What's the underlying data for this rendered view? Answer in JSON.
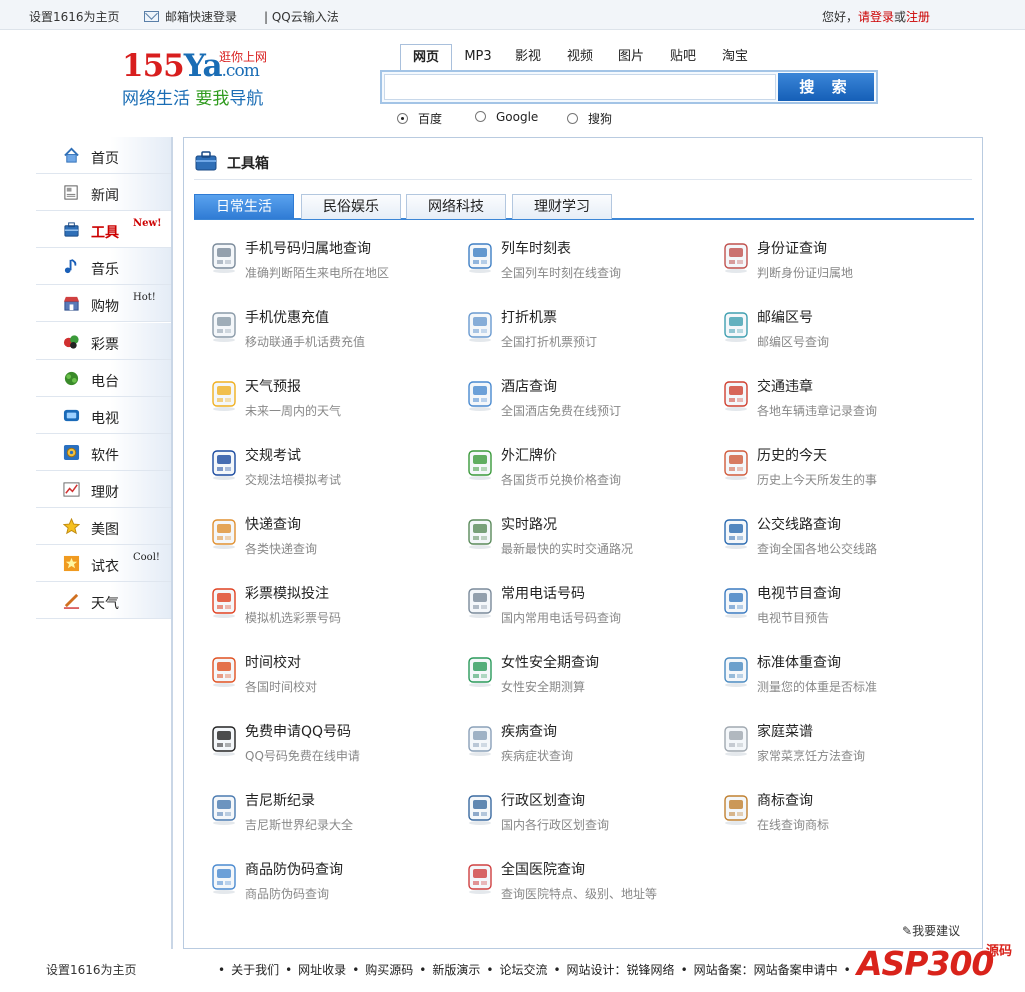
{
  "topbar": {
    "set_home": "设置1616为主页",
    "mail_login": "邮箱快速登录",
    "qq_input": "| QQ云输入法",
    "greeting": "您好，",
    "login": "请登录",
    "or": "或",
    "register": "注册"
  },
  "logo": {
    "num": "155",
    "brand": "Ya",
    "domain": ".com",
    "small": "逛你上网",
    "slogan_a": "网络生活 ",
    "slogan_b": "要我",
    "slogan_c": "导航"
  },
  "search": {
    "tabs": [
      "网页",
      "MP3",
      "影视",
      "视频",
      "图片",
      "贴吧",
      "淘宝"
    ],
    "active_tab": 0,
    "input_value": "",
    "button": "搜 索",
    "engines": [
      "百度",
      "Google",
      "搜狗"
    ],
    "selected_engine": 0
  },
  "sidebar": {
    "items": [
      {
        "label": "首页",
        "icon": "home-icon",
        "tag": ""
      },
      {
        "label": "新闻",
        "icon": "newspaper-icon",
        "tag": ""
      },
      {
        "label": "工具",
        "icon": "toolbox-icon",
        "tag": "New!"
      },
      {
        "label": "音乐",
        "icon": "music-note-icon",
        "tag": ""
      },
      {
        "label": "购物",
        "icon": "shop-icon",
        "tag": "Hot!"
      },
      {
        "label": "彩票",
        "icon": "lottery-balls-icon",
        "tag": ""
      },
      {
        "label": "电台",
        "icon": "radio-icon",
        "tag": ""
      },
      {
        "label": "电视",
        "icon": "tv-icon",
        "tag": ""
      },
      {
        "label": "软件",
        "icon": "software-gear-icon",
        "tag": ""
      },
      {
        "label": "理财",
        "icon": "finance-chart-icon",
        "tag": ""
      },
      {
        "label": "美图",
        "icon": "star-icon",
        "tag": ""
      },
      {
        "label": "试衣",
        "icon": "dress-star-icon",
        "tag": "Cool!"
      },
      {
        "label": "天气",
        "icon": "pencil-weather-icon",
        "tag": ""
      }
    ],
    "active": 2
  },
  "panel": {
    "title": "工具箱",
    "tabs": [
      "日常生活",
      "民俗娱乐",
      "网络科技",
      "理财学习"
    ],
    "active_tab": 0,
    "tools": [
      {
        "name": "手机号码归属地查询",
        "desc": "准确判断陌生来电所在地区",
        "icon": "mobile-phone-icon",
        "color": "#7a8a9a"
      },
      {
        "name": "列车时刻表",
        "desc": "全国列车时刻在线查询",
        "icon": "train-icon",
        "color": "#3f7fc4"
      },
      {
        "name": "身份证查询",
        "desc": "判断身份证归属地",
        "icon": "id-card-search-icon",
        "color": "#c0504d"
      },
      {
        "name": "手机优惠充值",
        "desc": "移动联通手机话费充值",
        "icon": "phone-recharge-icon",
        "color": "#8a9aa8"
      },
      {
        "name": "打折机票",
        "desc": "全国打折机票预订",
        "icon": "airplane-icon",
        "color": "#6a9ad0"
      },
      {
        "name": "邮编区号",
        "desc": "邮编区号查询",
        "icon": "postbox-icon",
        "color": "#3f9fb0"
      },
      {
        "name": "天气预报",
        "desc": "未来一周内的天气",
        "icon": "sun-cloud-icon",
        "color": "#f0b020"
      },
      {
        "name": "酒店查询",
        "desc": "全国酒店免费在线预订",
        "icon": "hotel-icon",
        "color": "#4a8ad0"
      },
      {
        "name": "交通违章",
        "desc": "各地车辆违章记录查询",
        "icon": "traffic-car-icon",
        "color": "#d04030"
      },
      {
        "name": "交规考试",
        "desc": "交规法培模拟考试",
        "icon": "no-uturn-sign-icon",
        "color": "#1a4aa0"
      },
      {
        "name": "外汇牌价",
        "desc": "各国货币兑换价格查询",
        "icon": "currency-icon",
        "color": "#3a9a3a"
      },
      {
        "name": "历史的今天",
        "desc": "历史上今天所发生的事",
        "icon": "calendar-icon",
        "color": "#d05a3a"
      },
      {
        "name": "快递查询",
        "desc": "各类快递查询",
        "icon": "delivery-search-icon",
        "color": "#e09030"
      },
      {
        "name": "实时路况",
        "desc": "最新最快的实时交通路况",
        "icon": "map-icon",
        "color": "#5a8a5a"
      },
      {
        "name": "公交线路查询",
        "desc": "查询全国各地公交线路",
        "icon": "bus-icon",
        "color": "#2a6ab0"
      },
      {
        "name": "彩票模拟投注",
        "desc": "模拟机选彩票号码",
        "icon": "lottery-logo-icon",
        "color": "#e04020"
      },
      {
        "name": "常用电话号码",
        "desc": "国内常用电话号码查询",
        "icon": "telephone-icon",
        "color": "#7a8a9a"
      },
      {
        "name": "电视节目查询",
        "desc": "电视节目预告",
        "icon": "television-icon",
        "color": "#3a7ac0"
      },
      {
        "name": "时间校对",
        "desc": "各国时间校对",
        "icon": "alarm-clock-icon",
        "color": "#e05020"
      },
      {
        "name": "女性安全期查询",
        "desc": "女性安全期测算",
        "icon": "woman-icon",
        "color": "#2a9a5a"
      },
      {
        "name": "标准体重查询",
        "desc": "测量您的体重是否标准",
        "icon": "scale-icon",
        "color": "#4a8ac0"
      },
      {
        "name": "免费申请QQ号码",
        "desc": "QQ号码免费在线申请",
        "icon": "qq-penguin-icon",
        "color": "#222222"
      },
      {
        "name": "疾病查询",
        "desc": "疾病症状查询",
        "icon": "doctor-icon",
        "color": "#8aa0b8"
      },
      {
        "name": "家庭菜谱",
        "desc": "家常菜烹饪方法查询",
        "icon": "recipe-icon",
        "color": "#a0a8b0"
      },
      {
        "name": "吉尼斯纪录",
        "desc": "吉尼斯世界纪录大全",
        "icon": "records-icon",
        "color": "#4a7ab0"
      },
      {
        "name": "行政区划查询",
        "desc": "国内各行政区划查询",
        "icon": "government-building-icon",
        "color": "#3a6aa0"
      },
      {
        "name": "商标查询",
        "desc": "在线查询商标",
        "icon": "trademark-search-icon",
        "color": "#c08030"
      },
      {
        "name": "商品防伪码查询",
        "desc": "商品防伪码查询",
        "icon": "anti-fake-code-icon",
        "color": "#4a8ad0"
      },
      {
        "name": "全国医院查询",
        "desc": "查询医院特点、级别、地址等",
        "icon": "hospital-search-icon",
        "color": "#d04040"
      }
    ]
  },
  "suggest": "我要建议",
  "footer": {
    "set_home": "设置1616为主页",
    "links": [
      "关于我们",
      "网址收录",
      "购买源码",
      "新版演示",
      "论坛交流",
      "网站设计：锐锋网络",
      "网站备案：网站备案申请中"
    ]
  },
  "watermark": {
    "text": "ASP300",
    "suffix": "源码"
  }
}
